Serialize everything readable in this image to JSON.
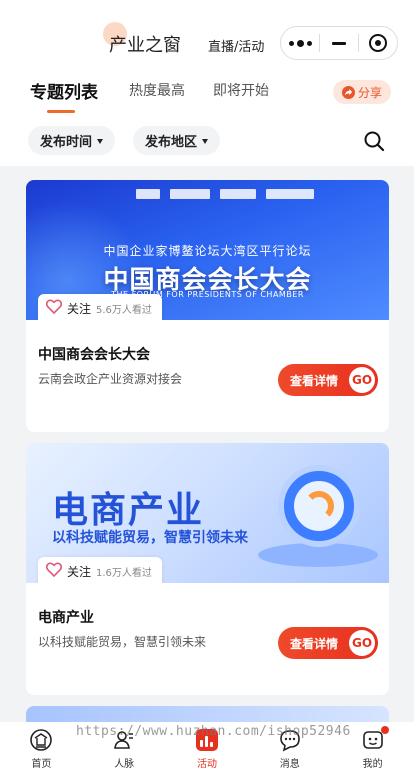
{
  "header": {
    "title": "产业之窗",
    "link": "直播/活动"
  },
  "capsule": {
    "more_icon": "more-dots-icon",
    "minimize_icon": "minus-icon",
    "close_icon": "target-icon"
  },
  "tabs": [
    {
      "label": "专题列表",
      "active": true
    },
    {
      "label": "热度最高",
      "active": false
    },
    {
      "label": "即将开始",
      "active": false
    }
  ],
  "share": {
    "label": "分享",
    "icon": "share-icon"
  },
  "filters": [
    {
      "label": "发布时间"
    },
    {
      "label": "发布地区"
    }
  ],
  "search": {
    "icon": "search-icon"
  },
  "cards": [
    {
      "banner": {
        "subtitle": "中国企业家博鳌论坛大湾区平行论坛",
        "headline": "中国商会会长大会",
        "english": "THE FORUM FOR PRESIDENTS OF CHAMBER"
      },
      "follow_label": "关注",
      "viewers": "5.6万人看过",
      "title": "中国商会会长大会",
      "description": "云南会政企产业资源对接会",
      "button": "查看详情",
      "go": "GO"
    },
    {
      "banner": {
        "headline": "电商产业",
        "subtitle": "以科技赋能贸易，智慧引领未来"
      },
      "follow_label": "关注",
      "viewers": "1.6万人看过",
      "title": "电商产业",
      "description": "以科技赋能贸易，智慧引领未来",
      "button": "查看详情",
      "go": "GO"
    }
  ],
  "tabbar": [
    {
      "label": "首页",
      "icon": "home-icon"
    },
    {
      "label": "人脉",
      "icon": "contacts-icon"
    },
    {
      "label": "活动",
      "icon": "activity-icon",
      "active": true
    },
    {
      "label": "消息",
      "icon": "message-icon"
    },
    {
      "label": "我的",
      "icon": "profile-icon",
      "badge": true
    }
  ],
  "watermark": "https://www.huzhan.com/ishop52946",
  "colors": {
    "accent": "#e8301f",
    "tab_underline": "#ef6b2c",
    "banner_blue": "#2553d8"
  }
}
